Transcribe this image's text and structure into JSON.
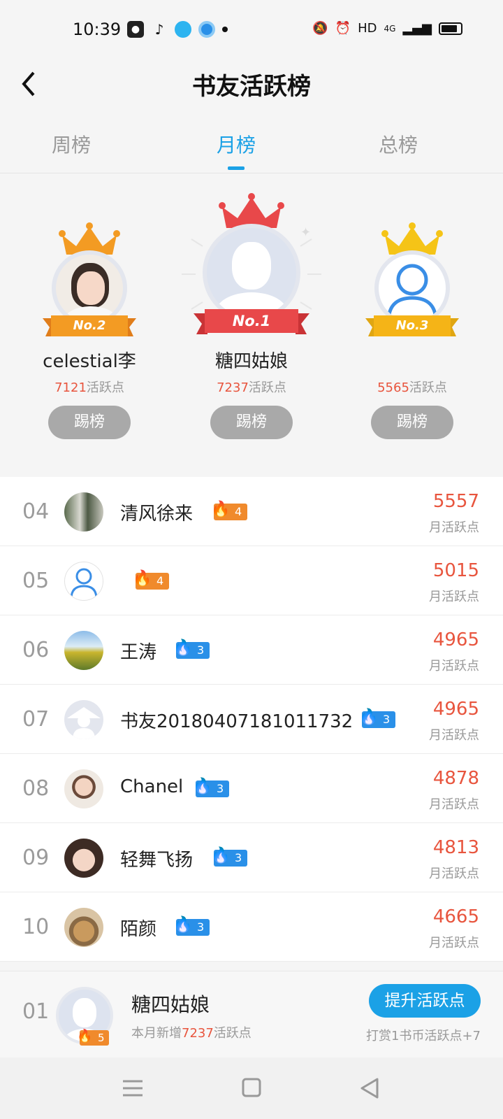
{
  "status_bar": {
    "time": "10:39",
    "network": "HD",
    "signal": "4G"
  },
  "header": {
    "title": "书友活跃榜",
    "back_icon": "chevron-left-icon"
  },
  "tabs": [
    {
      "label": "周榜",
      "active": false
    },
    {
      "label": "月榜",
      "active": true
    },
    {
      "label": "总榜",
      "active": false
    }
  ],
  "podium": {
    "points_suffix": "活跃点",
    "kick_label": "踢榜",
    "first": {
      "rank_label": "No.1",
      "name": "糖四姑娘",
      "points": "7237"
    },
    "second": {
      "rank_label": "No.2",
      "name": "celestial李",
      "points": "7121"
    },
    "third": {
      "rank_label": "No.3",
      "name": "",
      "points": "5565"
    }
  },
  "list": {
    "unit_label": "月活跃点",
    "rows": [
      {
        "rank": "04",
        "name": "清风徐来",
        "level": "4",
        "level_color": "orange",
        "score": "5557"
      },
      {
        "rank": "05",
        "name": "",
        "level": "4",
        "level_color": "orange",
        "score": "5015"
      },
      {
        "rank": "06",
        "name": "王涛",
        "level": "3",
        "level_color": "blue",
        "score": "4965"
      },
      {
        "rank": "07",
        "name": "书友20180407181011732",
        "level": "3",
        "level_color": "blue",
        "score": "4965"
      },
      {
        "rank": "08",
        "name": "Chanel",
        "level": "3",
        "level_color": "blue",
        "score": "4878"
      },
      {
        "rank": "09",
        "name": "轻舞飞扬",
        "level": "3",
        "level_color": "blue",
        "score": "4813"
      },
      {
        "rank": "10",
        "name": "陌颜",
        "level": "3",
        "level_color": "blue",
        "score": "4665"
      }
    ]
  },
  "mine": {
    "rank": "01",
    "name": "糖四姑娘",
    "level": "5",
    "sub_prefix": "本月新增",
    "sub_points": "7237",
    "sub_suffix": "活跃点",
    "boost_label": "提升活跃点",
    "tip": "打赏1书币活跃点+7"
  },
  "colors": {
    "accent": "#1ba1e6",
    "score": "#e8553e",
    "gold": "#f5b417",
    "orange": "#f08a2c",
    "red": "#e8484a"
  }
}
